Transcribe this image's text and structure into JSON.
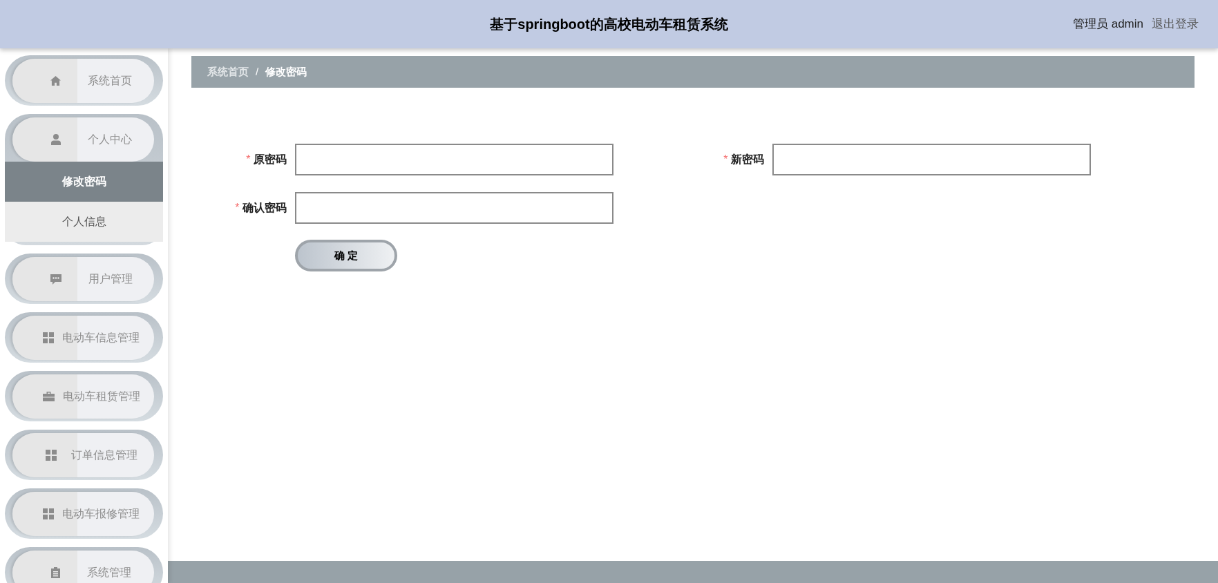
{
  "header": {
    "title": "基于springboot的高校电动车租赁系统",
    "user_label": "管理员 admin",
    "logout": "退出登录"
  },
  "sidebar": {
    "items": [
      {
        "label": "系统首页",
        "expanded": false
      },
      {
        "label": "个人中心",
        "expanded": true,
        "children": [
          {
            "label": "修改密码",
            "selected": true
          },
          {
            "label": "个人信息",
            "selected": false
          }
        ]
      },
      {
        "label": "用户管理",
        "expanded": false
      },
      {
        "label": "电动车信息管理",
        "expanded": false
      },
      {
        "label": "电动车租赁管理",
        "expanded": false
      },
      {
        "label": "订单信息管理",
        "expanded": false
      },
      {
        "label": "电动车报修管理",
        "expanded": false
      },
      {
        "label": "系统管理",
        "expanded": false
      }
    ]
  },
  "breadcrumb": {
    "separator": "/",
    "items": [
      {
        "label": "系统首页",
        "current": false
      },
      {
        "label": "修改密码",
        "current": true
      }
    ]
  },
  "form": {
    "fields": [
      {
        "label": "原密码",
        "marker": "*"
      },
      {
        "label": "新密码",
        "marker": "*"
      },
      {
        "label": "确认密码",
        "marker": "*"
      }
    ],
    "submit": "确 定"
  }
}
